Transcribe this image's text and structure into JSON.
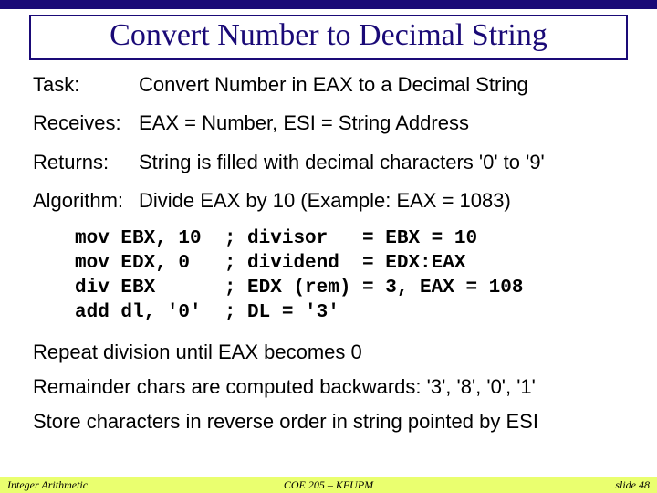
{
  "title": "Convert Number to Decimal String",
  "rows": {
    "task": {
      "label": "Task:",
      "text": "Convert Number in EAX to a Decimal String"
    },
    "receives": {
      "label": "Receives:",
      "text": "EAX = Number, ESI = String Address"
    },
    "returns": {
      "label": "Returns:",
      "text": "String is filled with decimal characters '0' to '9'"
    },
    "algorithm": {
      "label": "Algorithm:",
      "text": "Divide EAX by 10 (Example: EAX = 1083)"
    }
  },
  "code": "mov EBX, 10  ; divisor   = EBX = 10\nmov EDX, 0   ; dividend  = EDX:EAX\ndiv EBX      ; EDX (rem) = 3, EAX = 108\nadd dl, '0'  ; DL = '3'",
  "after": {
    "p1": "Repeat division until EAX becomes 0",
    "p2": "Remainder chars are computed backwards: '3', '8', '0', '1'",
    "p3": "Store characters in reverse order in string pointed by ESI"
  },
  "footer": {
    "left": "Integer Arithmetic",
    "center": "COE 205 – KFUPM",
    "right": "slide 48"
  }
}
